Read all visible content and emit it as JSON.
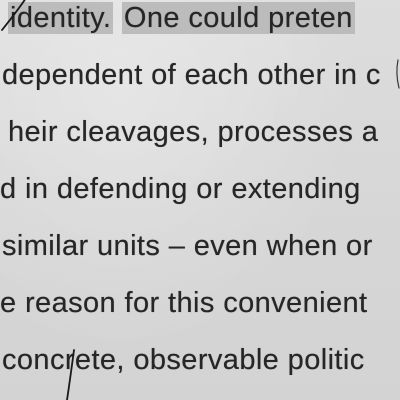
{
  "document": {
    "lines": [
      {
        "pre": "",
        "highlight_a": "identity.",
        "gap": " ",
        "highlight_b": "One could preten",
        "post": ""
      },
      {
        "pre": "dependent of each other in c",
        "highlight_a": "",
        "gap": "",
        "highlight_b": "",
        "post": ""
      },
      {
        "pre": "heir cleavages, processes a",
        "highlight_a": "",
        "gap": "",
        "highlight_b": "",
        "post": ""
      },
      {
        "pre": "d in defending or extending",
        "highlight_a": "",
        "gap": "",
        "highlight_b": "",
        "post": ""
      },
      {
        "pre": "similar units – even when or",
        "highlight_a": "",
        "gap": "",
        "highlight_b": "",
        "post": ""
      },
      {
        "pre": "e reason for this convenient",
        "highlight_a": "",
        "gap": "",
        "highlight_b": "",
        "post": ""
      },
      {
        "pre": "concrete, observable politic",
        "highlight_a": "",
        "gap": "",
        "highlight_b": "",
        "post": ""
      }
    ]
  },
  "colors": {
    "paper": "#d6d6d6",
    "ink": "#2a2a2a",
    "highlight": "#b9b9b9",
    "pen_mark": "#1e1e1e"
  }
}
